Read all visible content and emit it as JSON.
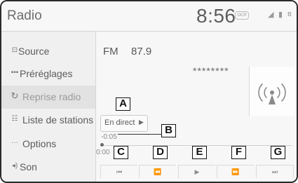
{
  "header": {
    "title": "Radio",
    "clock": "8:56",
    "status_badge": "OCR",
    "status_icons": [
      "signal-icon",
      "battery-icon",
      "bluetooth-icon"
    ]
  },
  "sidebar": {
    "items": [
      {
        "label": "Source",
        "icon": "source-icon"
      },
      {
        "label": "Préréglages",
        "icon": "presets-icon"
      },
      {
        "label": "Reprise radio",
        "icon": "replay-icon",
        "active": true
      },
      {
        "label": "Liste de stations",
        "icon": "station-list-icon"
      },
      {
        "label": "Options",
        "icon": "options-icon"
      },
      {
        "label": "Son",
        "icon": "sound-icon"
      }
    ]
  },
  "main": {
    "band": "FM",
    "frequency": "87.9",
    "station_text": "********",
    "live_button": "En direct",
    "time_offset": "-0:05",
    "time_zero": "0:00"
  },
  "controls": [
    "⏮",
    "⏪",
    "▶",
    "⏩",
    "⏭"
  ],
  "callouts": [
    "A",
    "B",
    "C",
    "D",
    "E",
    "F",
    "G"
  ],
  "colors": {
    "screen_bg": "#f4f4f4",
    "text": "#5c5c5c",
    "active_row": "#e2e2e2"
  }
}
